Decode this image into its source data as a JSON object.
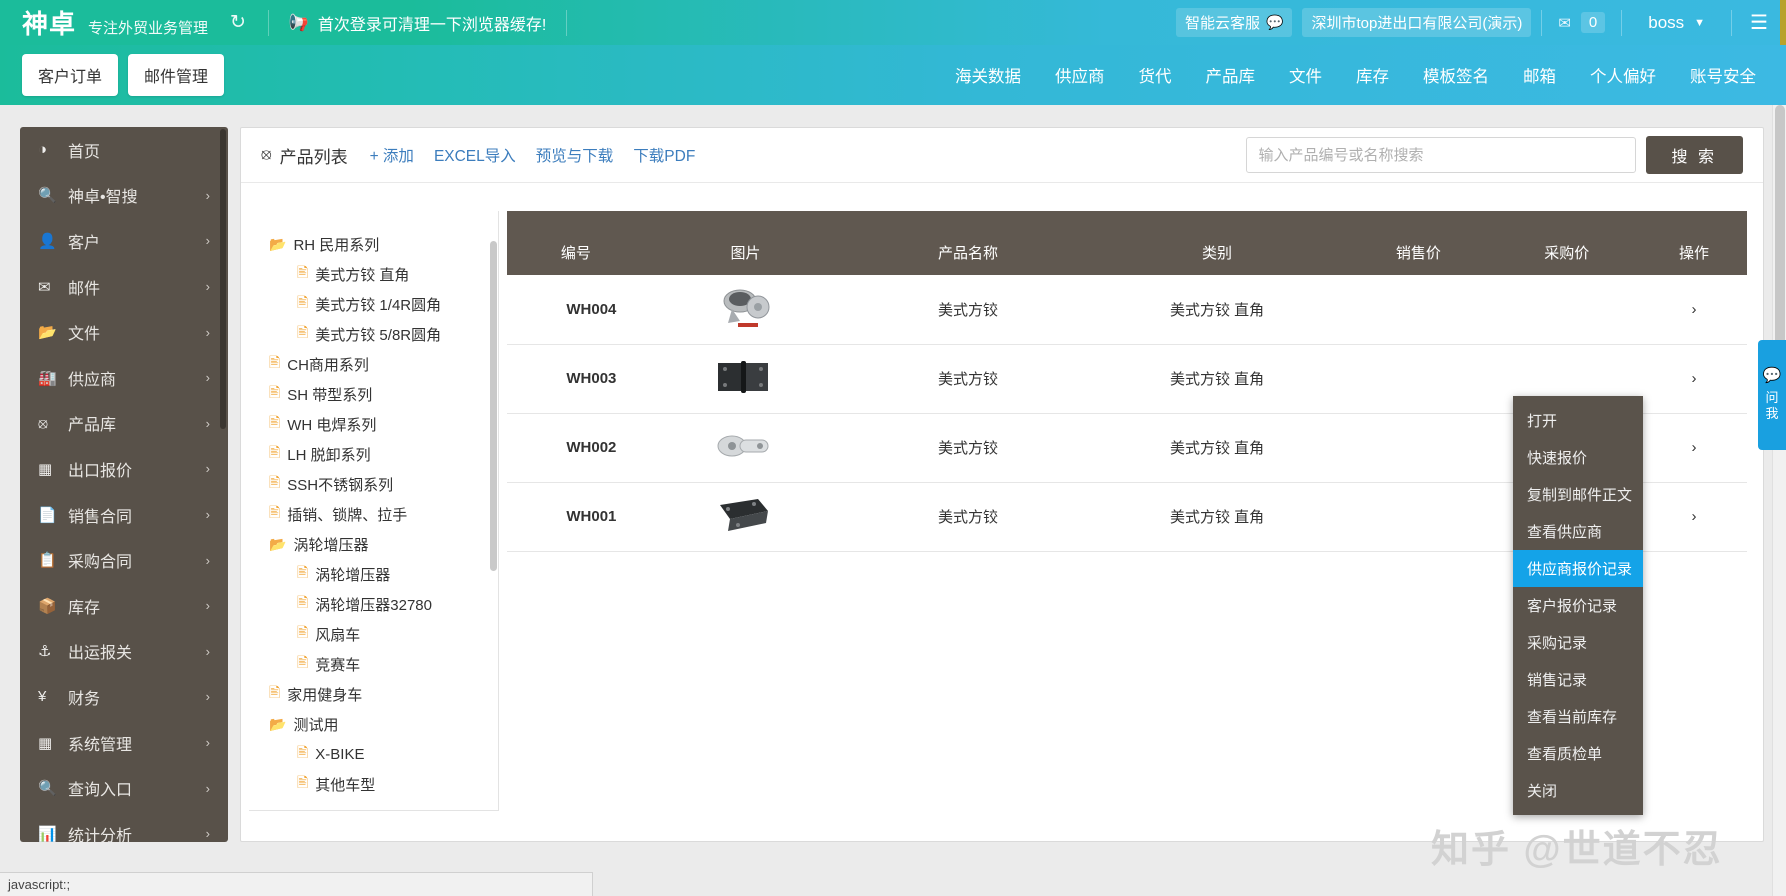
{
  "topbar": {
    "logo": "神卓",
    "subtitle": "专注外贸业务管理",
    "refresh_icon": "refresh-icon",
    "notice": "首次登录可清理一下浏览器缓存!",
    "cloud_service": "智能云客服",
    "company": "深圳市top进出口有限公司(演示)",
    "mail_count": "0",
    "user": "boss",
    "menu_icon": "hamburger-icon"
  },
  "navbar": {
    "buttons": [
      {
        "label": "客户订单"
      },
      {
        "label": "邮件管理"
      }
    ],
    "links": [
      {
        "label": "海关数据"
      },
      {
        "label": "供应商"
      },
      {
        "label": "货代"
      },
      {
        "label": "产品库"
      },
      {
        "label": "文件"
      },
      {
        "label": "库存"
      },
      {
        "label": "模板签名"
      },
      {
        "label": "邮箱"
      },
      {
        "label": "个人偏好"
      },
      {
        "label": "账号安全"
      }
    ]
  },
  "sidebar": {
    "items": [
      {
        "label": "首页",
        "icon": "dashboard-icon",
        "chevron": ""
      },
      {
        "label": "神卓•智搜",
        "icon": "search-icon",
        "chevron": "›"
      },
      {
        "label": "客户",
        "icon": "user-add-icon",
        "chevron": "›"
      },
      {
        "label": "邮件",
        "icon": "envelope-icon",
        "chevron": "›"
      },
      {
        "label": "文件",
        "icon": "folder-open-icon",
        "chevron": "›"
      },
      {
        "label": "供应商",
        "icon": "factory-icon",
        "chevron": "›"
      },
      {
        "label": "产品库",
        "icon": "cubes-icon",
        "chevron": "›"
      },
      {
        "label": "出口报价",
        "icon": "grid-icon",
        "chevron": "›"
      },
      {
        "label": "销售合同",
        "icon": "document-icon",
        "chevron": "›"
      },
      {
        "label": "采购合同",
        "icon": "copy-icon",
        "chevron": "›"
      },
      {
        "label": "库存",
        "icon": "box-icon",
        "chevron": "›"
      },
      {
        "label": "出运报关",
        "icon": "anchor-icon",
        "chevron": "›"
      },
      {
        "label": "财务",
        "icon": "yen-icon",
        "chevron": "›"
      },
      {
        "label": "系统管理",
        "icon": "blocks-icon",
        "chevron": "›"
      },
      {
        "label": "查询入口",
        "icon": "magnifier-icon",
        "chevron": "›"
      },
      {
        "label": "统计分析",
        "icon": "bar-chart-icon",
        "chevron": "›"
      }
    ]
  },
  "panel": {
    "title": "产品列表",
    "title_icon": "cubes-icon",
    "actions": [
      {
        "label": "+ 添加"
      },
      {
        "label": "EXCEL导入"
      },
      {
        "label": "预览与下载"
      },
      {
        "label": "下载PDF"
      }
    ],
    "search": {
      "placeholder": "输入产品编号或名称搜索",
      "value": "",
      "button": "搜 索"
    }
  },
  "tree": {
    "nodes": [
      {
        "label": "RH 民用系列",
        "type": "folder",
        "depth": 0
      },
      {
        "label": "美式方铰 直角",
        "type": "file",
        "depth": 1
      },
      {
        "label": "美式方铰 1/4R圆角",
        "type": "file",
        "depth": 1
      },
      {
        "label": "美式方铰 5/8R圆角",
        "type": "file",
        "depth": 1
      },
      {
        "label": "CH商用系列",
        "type": "file",
        "depth": 0
      },
      {
        "label": "SH 带型系列",
        "type": "file",
        "depth": 0
      },
      {
        "label": "WH 电焊系列",
        "type": "file",
        "depth": 0
      },
      {
        "label": "LH 脱卸系列",
        "type": "file",
        "depth": 0
      },
      {
        "label": "SSH不锈钢系列",
        "type": "file",
        "depth": 0
      },
      {
        "label": "插销、锁牌、拉手",
        "type": "file",
        "depth": 0
      },
      {
        "label": "涡轮增压器",
        "type": "folder",
        "depth": 0
      },
      {
        "label": "涡轮增压器",
        "type": "file",
        "depth": 1
      },
      {
        "label": "涡轮增压器32780",
        "type": "file",
        "depth": 1
      },
      {
        "label": "风扇车",
        "type": "file",
        "depth": 1
      },
      {
        "label": "竞赛车",
        "type": "file",
        "depth": 1
      },
      {
        "label": "家用健身车",
        "type": "file",
        "depth": 0
      },
      {
        "label": "测试用",
        "type": "folder",
        "depth": 0
      },
      {
        "label": "X-BIKE",
        "type": "file",
        "depth": 1
      },
      {
        "label": "其他车型",
        "type": "file",
        "depth": 1
      }
    ]
  },
  "table": {
    "columns": [
      "编号",
      "图片",
      "产品名称",
      "类别",
      "销售价",
      "采购价",
      "操作"
    ],
    "rows": [
      {
        "code": "WH004",
        "image": "product-thumb-wh004",
        "name": "美式方铰",
        "category": "美式方铰 直角",
        "sale_price": "",
        "purchase_price": "",
        "action": "›"
      },
      {
        "code": "WH003",
        "image": "product-thumb-wh003",
        "name": "美式方铰",
        "category": "美式方铰 直角",
        "sale_price": "",
        "purchase_price": "",
        "action": "›"
      },
      {
        "code": "WH002",
        "image": "product-thumb-wh002",
        "name": "美式方铰",
        "category": "美式方铰 直角",
        "sale_price": "",
        "purchase_price": "",
        "action": "›"
      },
      {
        "code": "WH001",
        "image": "product-thumb-wh001",
        "name": "美式方铰",
        "category": "美式方铰 直角",
        "sale_price": "",
        "purchase_price": "",
        "action": "›"
      }
    ]
  },
  "context_menu": {
    "items": [
      {
        "label": "打开",
        "active": false
      },
      {
        "label": "快速报价",
        "active": false
      },
      {
        "label": "复制到邮件正文",
        "active": false
      },
      {
        "label": "查看供应商",
        "active": false
      },
      {
        "label": "供应商报价记录",
        "active": true
      },
      {
        "label": "客户报价记录",
        "active": false
      },
      {
        "label": "采购记录",
        "active": false
      },
      {
        "label": "销售记录",
        "active": false
      },
      {
        "label": "查看当前库存",
        "active": false
      },
      {
        "label": "查看质检单",
        "active": false
      },
      {
        "label": "关闭",
        "active": false
      }
    ]
  },
  "chat_tab": {
    "icon": "chat-bubble-icon",
    "line1": "问",
    "line2": "我"
  },
  "watermark": "知乎 @世道不忍",
  "statusbar": {
    "text": "javascript:;"
  },
  "colors": {
    "teal": "#1bbc9b",
    "blue": "#3ab9e0",
    "sidebar": "#585149",
    "table_header": "#605850",
    "highlight": "#14a3e8",
    "link": "#3c7dbd"
  }
}
